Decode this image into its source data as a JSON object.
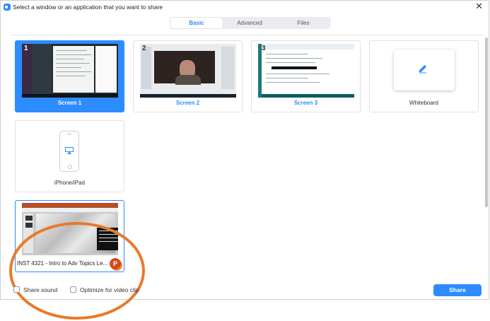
{
  "window": {
    "title": "Select a window or an application that you want to share",
    "close_glyph": "✕"
  },
  "tabs": [
    {
      "label": "Basic",
      "selected": true
    },
    {
      "label": "Advanced",
      "selected": false
    },
    {
      "label": "Files",
      "selected": false
    }
  ],
  "tiles": {
    "screen1": {
      "label": "Screen 1",
      "number": "1",
      "selected": true
    },
    "screen2": {
      "label": "Screen 2",
      "number": "2"
    },
    "screen3": {
      "label": "Screen 3",
      "number": "3"
    },
    "whiteboard": {
      "label": "Whiteboard",
      "icon": "pencil-icon"
    },
    "iphone": {
      "label": "iPhone/iPad",
      "icon": "airplay-icon"
    },
    "powerpoint": {
      "label": "INST 4321 - Intro to Adv Topics Le...",
      "badge": "P",
      "icon": "powerpoint-icon"
    }
  },
  "footer": {
    "share_sound_label": "Share sound",
    "share_sound_checked": false,
    "optimize_label": "Optimize for video clip",
    "optimize_checked": false,
    "share_button": "Share"
  },
  "colors": {
    "accent": "#2d8cff",
    "highlight_ring": "#e87a2b",
    "powerpoint": "#d14a1e"
  }
}
